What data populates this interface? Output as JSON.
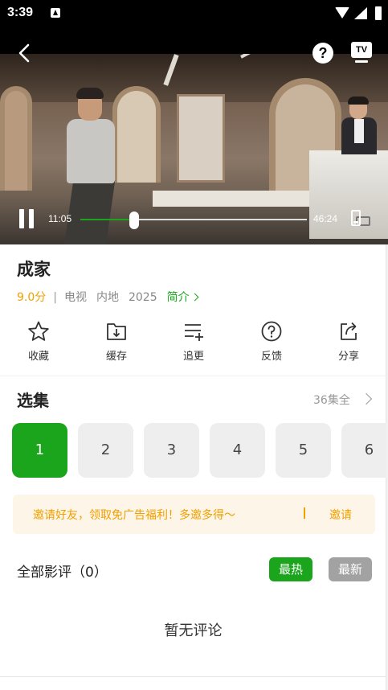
{
  "status_bar": {
    "time": "3:39"
  },
  "player": {
    "current_time": "11:05",
    "total_time": "46:24",
    "progress_fraction": 0.239,
    "tv_label": "TV",
    "help_label": "?"
  },
  "show": {
    "title": "成家",
    "score": "9.0分",
    "separator": "|",
    "type": "电视",
    "region": "内地",
    "year": "2025",
    "intro_label": "简介"
  },
  "actions": [
    {
      "label": "收藏",
      "icon": "star-icon"
    },
    {
      "label": "缓存",
      "icon": "download-icon"
    },
    {
      "label": "追更",
      "icon": "playlist-add-icon"
    },
    {
      "label": "反馈",
      "icon": "question-icon"
    },
    {
      "label": "分享",
      "icon": "share-icon"
    }
  ],
  "episodes": {
    "title": "选集",
    "all_label": "36集全",
    "items": [
      "1",
      "2",
      "3",
      "4",
      "5",
      "6"
    ],
    "active_index": 0
  },
  "invite": {
    "text": "邀请好友，领取免广告福利！多邀多得～",
    "button_label": "邀请"
  },
  "comments": {
    "title": "全部影评（0）",
    "sort_hot": "最热",
    "sort_new": "最新",
    "empty_text": "暂无评论"
  },
  "colors": {
    "accent": "#1aa51c",
    "score": "#f0a000",
    "banner_bg": "#fdf5e7"
  }
}
